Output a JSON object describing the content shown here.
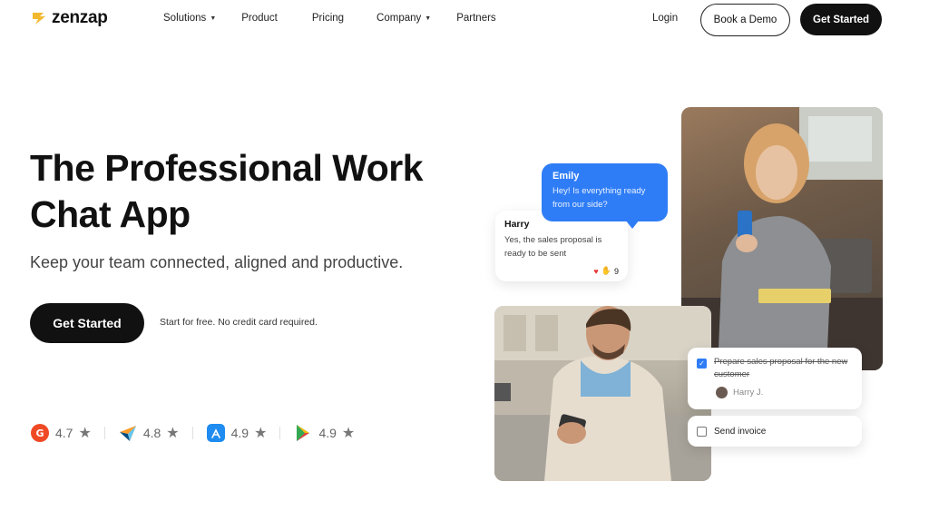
{
  "brand": {
    "name": "zenzap",
    "logo_color": "#f2b92e"
  },
  "nav": {
    "items": [
      {
        "label": "Solutions",
        "has_dropdown": true
      },
      {
        "label": "Product",
        "has_dropdown": false
      },
      {
        "label": "Pricing",
        "has_dropdown": false
      },
      {
        "label": "Company",
        "has_dropdown": true
      },
      {
        "label": "Partners",
        "has_dropdown": false
      }
    ],
    "login_label": "Login",
    "demo_label": "Book a Demo",
    "get_started_label": "Get Started"
  },
  "hero": {
    "title_line1": "The Professional Work",
    "title_line2": "Chat App",
    "subtitle": "Keep your team connected, aligned and productive.",
    "cta_label": "Get Started",
    "cta_note": "Start for free. No credit card required."
  },
  "ratings": [
    {
      "source_icon": "g2-icon",
      "value": "4.7"
    },
    {
      "source_icon": "capterra-icon",
      "value": "4.8"
    },
    {
      "source_icon": "app-store-icon",
      "value": "4.9"
    },
    {
      "source_icon": "google-play-icon",
      "value": "4.9"
    }
  ],
  "chat": {
    "harry": {
      "name": "Harry",
      "message": "Yes, the sales proposal is ready to be sent",
      "reaction_count": "9"
    },
    "emily": {
      "name": "Emily",
      "message": "Hey! Is everything ready from our side?"
    }
  },
  "tasks": {
    "done_task": "Prepare sales proposal for the new customer",
    "assignee": "Harry J.",
    "open_task": "Send invoice"
  },
  "colors": {
    "accent_blue": "#2f7df6",
    "dark": "#111111"
  }
}
